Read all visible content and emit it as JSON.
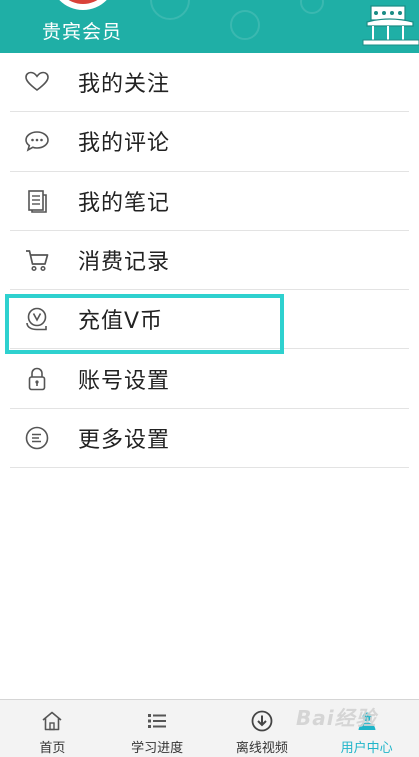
{
  "header": {
    "vip_label": "贵宾会员"
  },
  "menu": {
    "items": [
      {
        "label": "我的关注",
        "icon": "heart-icon"
      },
      {
        "label": "我的评论",
        "icon": "comment-icon"
      },
      {
        "label": "我的笔记",
        "icon": "notes-icon"
      },
      {
        "label": "消费记录",
        "icon": "cart-icon"
      },
      {
        "label": "充值V币",
        "icon": "vcoin-icon"
      },
      {
        "label": "账号设置",
        "icon": "lock-icon"
      },
      {
        "label": "更多设置",
        "icon": "more-settings-icon"
      }
    ]
  },
  "tabbar": {
    "tabs": [
      {
        "label": "首页",
        "icon": "home-icon"
      },
      {
        "label": "学习进度",
        "icon": "list-icon"
      },
      {
        "label": "离线视频",
        "icon": "download-icon"
      },
      {
        "label": "用户中心",
        "icon": "user-icon",
        "active": true
      }
    ]
  },
  "watermark": {
    "text": "Bai经验"
  },
  "colors": {
    "header_bg": "#1fafa6",
    "highlight": "#2ed1cf",
    "active_tab": "#1fb5c9"
  }
}
